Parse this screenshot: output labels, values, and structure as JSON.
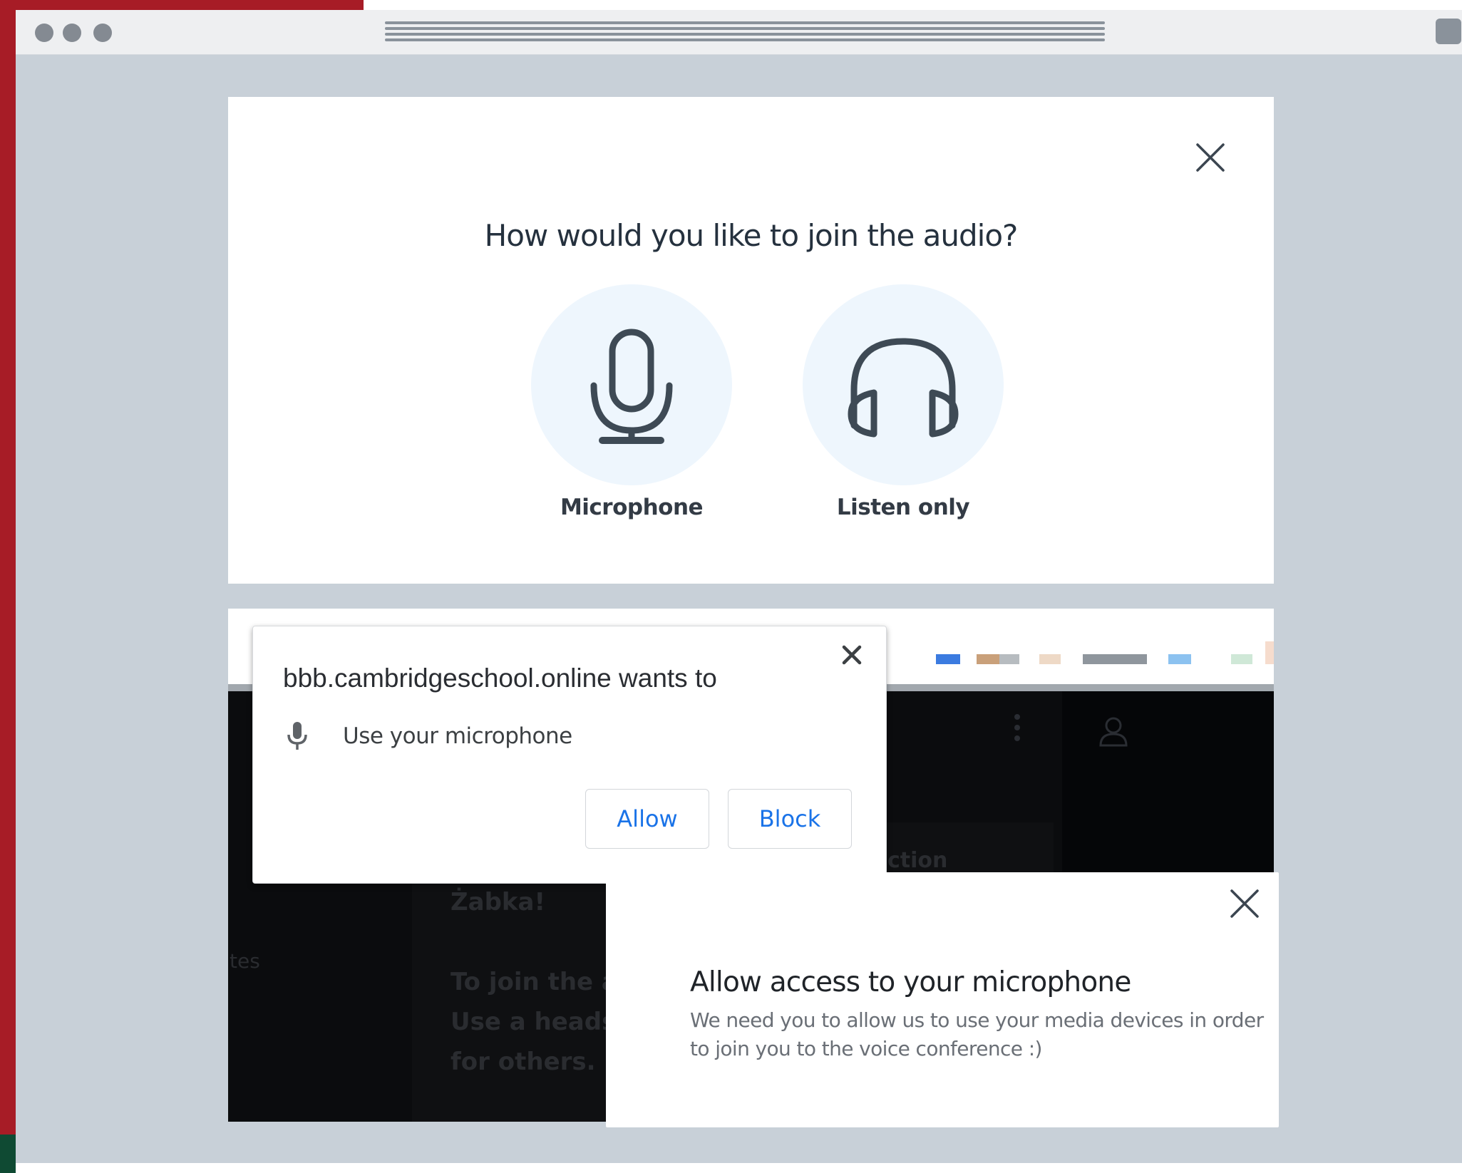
{
  "audio_dialog": {
    "title": "How would you like to join the audio?",
    "options": [
      {
        "label": "Microphone",
        "icon": "microphone-icon"
      },
      {
        "label": "Listen only",
        "icon": "headphones-icon"
      }
    ],
    "close_icon": "close-icon"
  },
  "permission_popup": {
    "title": "bbb.cambridgeschool.online wants to",
    "request": "Use your microphone",
    "allow_label": "Allow",
    "block_label": "Block"
  },
  "access_modal": {
    "title": "Allow access to your microphone",
    "description": "We need you to allow us to use your media devices in order to join you to the voice conference :)"
  },
  "background_text": {
    "line1": "Żabka!",
    "line2": "To join the a",
    "line3": "Use a headse",
    "line4": "for others.",
    "side": "tes",
    "peek": "ction"
  },
  "colors": {
    "accent_blue": "#1a73e8",
    "option_circle": "#eef6fd",
    "icon_stroke": "#3e4a55",
    "backdrop": "#c8d0d8"
  }
}
